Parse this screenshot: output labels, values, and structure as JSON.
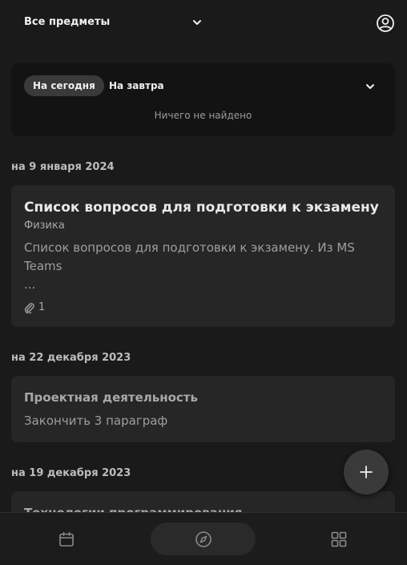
{
  "header": {
    "subject_filter_label": "Все предметы",
    "chevron_icon": "chevron-down-icon",
    "profile_icon": "user-circle-icon"
  },
  "filter_panel": {
    "tab_today": "На сегодня",
    "tab_tomorrow": "На завтра",
    "empty_message": "Ничего не найдено"
  },
  "sections": [
    {
      "date_label": "на 9 января 2024",
      "card": {
        "title": "Список вопросов для подготовки к экзамену",
        "subject": "Физика",
        "body_line1": "Список вопросов для подготовки к экзамену. Из MS",
        "body_line2": "Teams",
        "body_ellipsis": "...",
        "attachments_count": "1"
      }
    },
    {
      "date_label": "на 22 декабря 2023",
      "card": {
        "title": "Проектная деятельность",
        "body": "Закончить 3 параграф"
      }
    },
    {
      "date_label": "на 19 декабря 2023",
      "card": {
        "title": "Технологии программирования"
      }
    }
  ],
  "fab": {
    "label": "+"
  },
  "bottom_nav": {
    "items": [
      "calendar-icon",
      "compass-icon",
      "grid-icon"
    ],
    "active": "compass-icon"
  },
  "colors": {
    "background": "#1a1a1a",
    "panel": "#131313",
    "card": "#262626",
    "pill_active": "#3a3a3a"
  }
}
